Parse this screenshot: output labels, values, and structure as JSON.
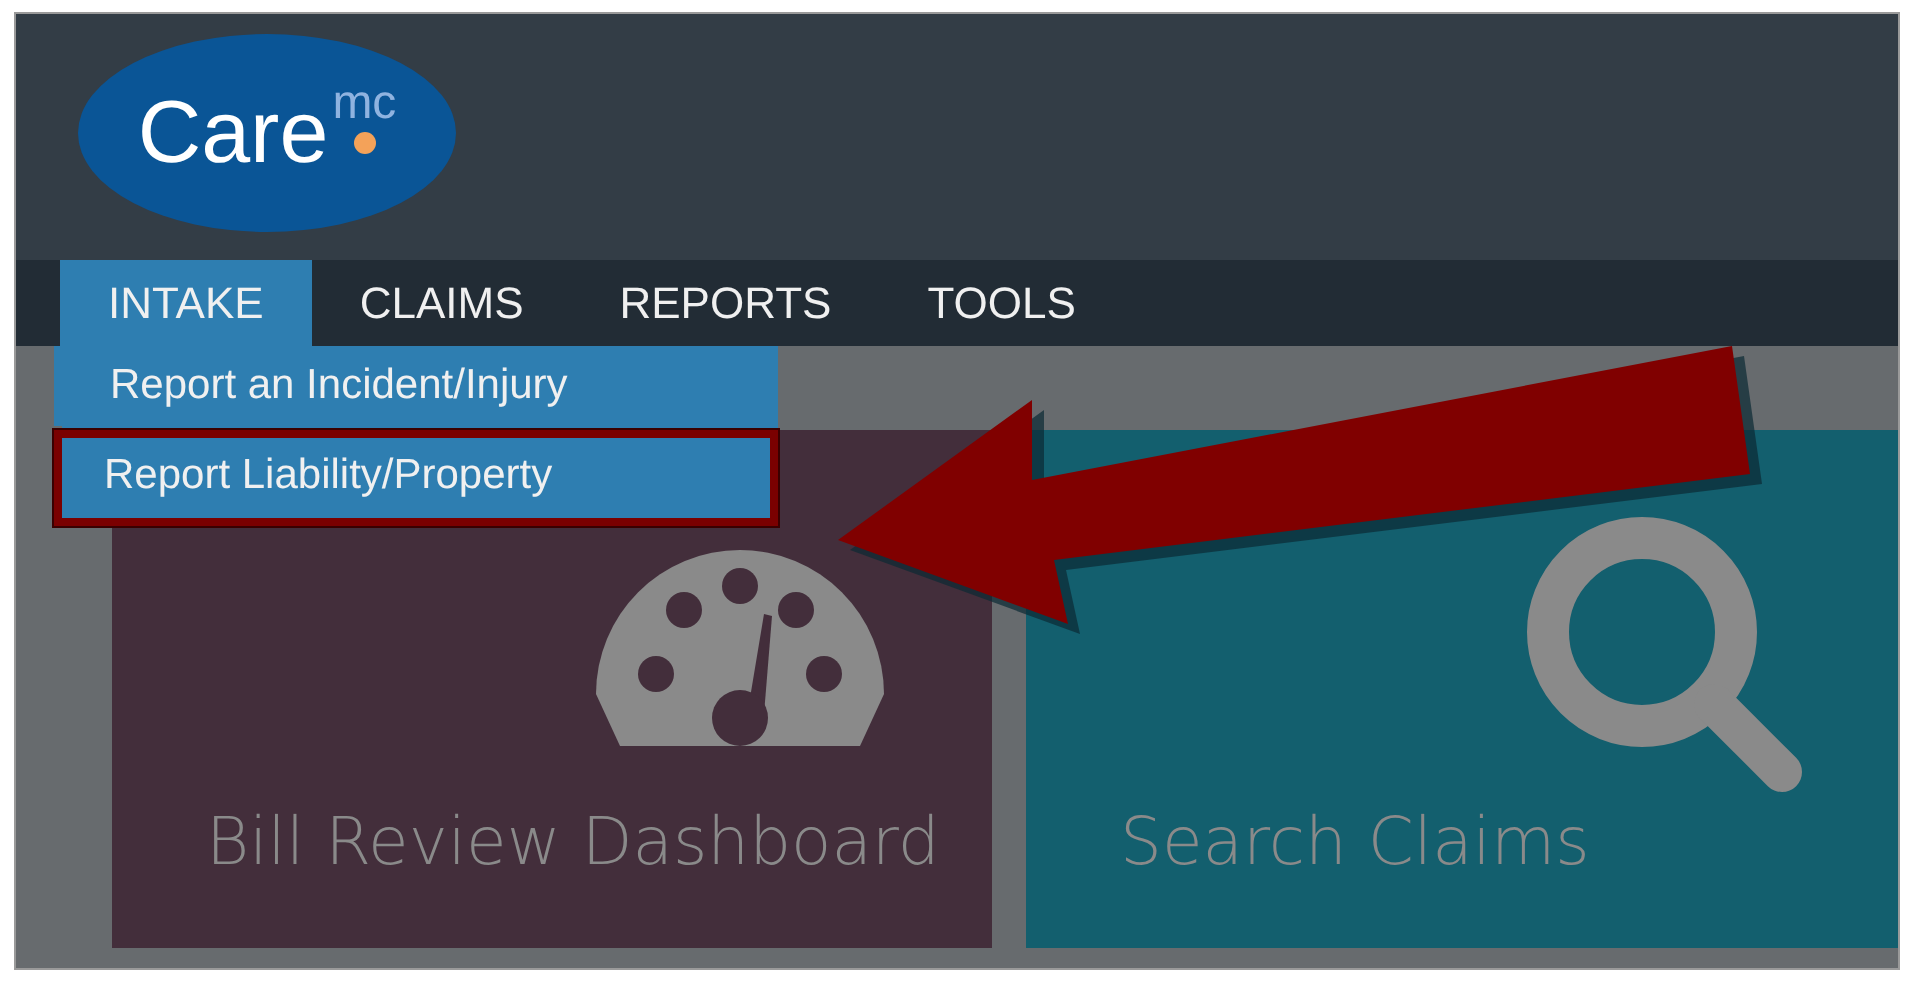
{
  "logo": {
    "text": "Care",
    "superscript": "mc"
  },
  "nav": [
    {
      "label": "INTAKE",
      "selected": true
    },
    {
      "label": "CLAIMS",
      "selected": false
    },
    {
      "label": "REPORTS",
      "selected": false
    },
    {
      "label": "TOOLS",
      "selected": false
    }
  ],
  "dropdown": [
    {
      "label": "Report an Incident/Injury",
      "outlined": false
    },
    {
      "label": "Report Liability/Property",
      "outlined": true
    }
  ],
  "tiles": [
    {
      "label": "Bill Review Dashboard",
      "kind": "dashboard",
      "color": "#432e3b"
    },
    {
      "label": "Search Claims",
      "kind": "search",
      "color": "#135f6e"
    }
  ],
  "annotation": {
    "kind": "arrow"
  }
}
